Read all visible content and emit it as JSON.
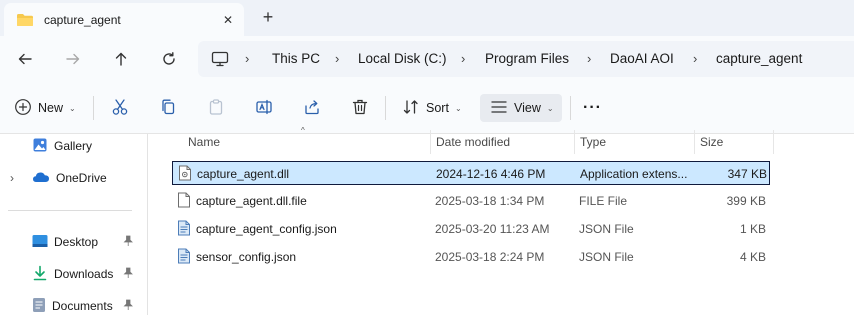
{
  "tab": {
    "title": "capture_agent",
    "close_glyph": "✕",
    "new_glyph": "+"
  },
  "breadcrumbs": [
    "This PC",
    "Local Disk (C:)",
    "Program Files",
    "DaoAI AOI",
    "capture_agent"
  ],
  "breadcrumb_separator": "›",
  "toolbar": {
    "new_label": "New",
    "sort_label": "Sort",
    "view_label": "View",
    "more_glyph": "···",
    "caret_glyph": "⌄"
  },
  "sidebar": {
    "items": [
      {
        "label": "Gallery",
        "icon": "gallery-icon"
      },
      {
        "label": "OneDrive",
        "icon": "onedrive-icon"
      },
      {
        "label": "Desktop",
        "icon": "desktop-icon",
        "pinned": true
      },
      {
        "label": "Downloads",
        "icon": "downloads-icon",
        "pinned": true
      },
      {
        "label": "Documents",
        "icon": "documents-icon",
        "pinned": true
      }
    ],
    "expand_glyph": "›"
  },
  "columns": {
    "name": "Name",
    "date": "Date modified",
    "type": "Type",
    "size": "Size"
  },
  "sort_indicator": "^",
  "files": [
    {
      "name": "capture_agent.dll",
      "date": "2024-12-16 4:46 PM",
      "type": "Application extens...",
      "size": "347 KB",
      "icon": "dll-file-icon",
      "selected": true
    },
    {
      "name": "capture_agent.dll.file",
      "date": "2025-03-18 1:34 PM",
      "type": "FILE File",
      "size": "399 KB",
      "icon": "generic-file-icon",
      "selected": false
    },
    {
      "name": "capture_agent_config.json",
      "date": "2025-03-20 11:23 AM",
      "type": "JSON File",
      "size": "1 KB",
      "icon": "json-file-icon",
      "selected": false
    },
    {
      "name": "sensor_config.json",
      "date": "2025-03-18 2:24 PM",
      "type": "JSON File",
      "size": "4 KB",
      "icon": "json-file-icon",
      "selected": false
    }
  ],
  "colors": {
    "accent": "#0078d4",
    "selection": "#cce8ff",
    "folder": "#f6c94e"
  }
}
